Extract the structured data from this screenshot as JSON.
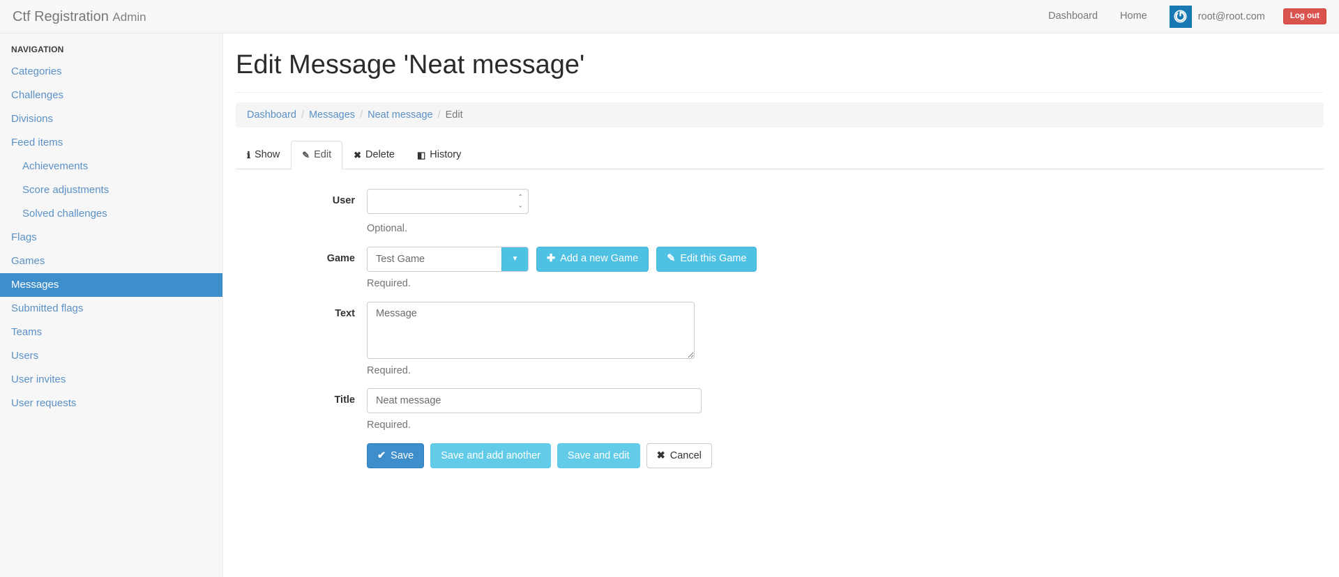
{
  "navbar": {
    "brand_main": "Ctf Registration",
    "brand_sub": "Admin",
    "links": [
      {
        "label": "Dashboard"
      },
      {
        "label": "Home"
      }
    ],
    "user_email": "root@root.com",
    "logout_label": "Log out",
    "gravatar_icon": "power-icon",
    "logout_color": "#d9534f"
  },
  "sidebar": {
    "header": "NAVIGATION",
    "active_color": "#3e8ecc",
    "link_color": "#5b91c7",
    "items": [
      {
        "label": "Categories",
        "sub": false,
        "active": false
      },
      {
        "label": "Challenges",
        "sub": false,
        "active": false
      },
      {
        "label": "Divisions",
        "sub": false,
        "active": false
      },
      {
        "label": "Feed items",
        "sub": false,
        "active": false
      },
      {
        "label": "Achievements",
        "sub": true,
        "active": false
      },
      {
        "label": "Score adjustments",
        "sub": true,
        "active": false
      },
      {
        "label": "Solved challenges",
        "sub": true,
        "active": false
      },
      {
        "label": "Flags",
        "sub": false,
        "active": false
      },
      {
        "label": "Games",
        "sub": false,
        "active": false
      },
      {
        "label": "Messages",
        "sub": false,
        "active": true
      },
      {
        "label": "Submitted flags",
        "sub": false,
        "active": false
      },
      {
        "label": "Teams",
        "sub": false,
        "active": false
      },
      {
        "label": "Users",
        "sub": false,
        "active": false
      },
      {
        "label": "User invites",
        "sub": false,
        "active": false
      },
      {
        "label": "User requests",
        "sub": false,
        "active": false
      }
    ]
  },
  "main": {
    "page_title": "Edit Message 'Neat message'",
    "breadcrumb": [
      {
        "label": "Dashboard",
        "link": true
      },
      {
        "label": "Messages",
        "link": true
      },
      {
        "label": "Neat message",
        "link": true
      },
      {
        "label": "Edit",
        "link": false
      }
    ],
    "breadcrumb_separator": "/",
    "tabs": [
      {
        "label": "Show",
        "icon": "info-icon",
        "glyph": "ℹ",
        "active": false
      },
      {
        "label": "Edit",
        "icon": "pencil-icon",
        "glyph": "✎",
        "active": true
      },
      {
        "label": "Delete",
        "icon": "cross-icon",
        "glyph": "✖",
        "active": false
      },
      {
        "label": "History",
        "icon": "book-icon",
        "glyph": "◧",
        "active": false
      }
    ],
    "form": {
      "user": {
        "label": "User",
        "value": "",
        "placeholder": "",
        "help": "Optional.",
        "spinner_up": "⌃",
        "spinner_down": "⌄"
      },
      "game": {
        "label": "Game",
        "value": "Test Game",
        "help": "Required.",
        "toggle_glyph": "▼",
        "add_button": "Add a new Game",
        "add_button_glyph": "✚",
        "edit_button": "Edit this Game",
        "edit_button_glyph": "✎"
      },
      "text": {
        "label": "Text",
        "value": "Message",
        "help": "Required."
      },
      "title": {
        "label": "Title",
        "value": "Neat message",
        "help": "Required."
      },
      "actions": [
        {
          "label": "Save",
          "glyph": "✔",
          "style": "primary"
        },
        {
          "label": "Save and add another",
          "glyph": "",
          "style": "info-light"
        },
        {
          "label": "Save and edit",
          "glyph": "",
          "style": "info-light"
        },
        {
          "label": "Cancel",
          "glyph": "✖",
          "style": "default"
        }
      ]
    }
  }
}
